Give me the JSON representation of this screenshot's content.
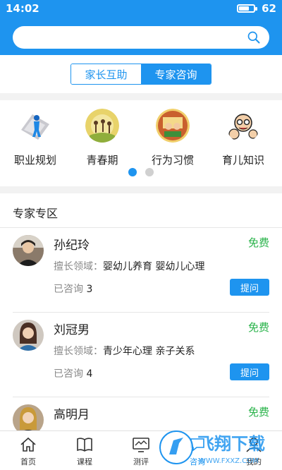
{
  "status": {
    "time": "14:02",
    "battery_level": "62",
    "battery_fraction": 0.62
  },
  "search": {
    "placeholder": ""
  },
  "segment": {
    "left_label": "家长互助",
    "right_label": "专家咨询",
    "selected": "专家咨询"
  },
  "categories": [
    {
      "label": "职业规划",
      "icon": "career-planning-icon"
    },
    {
      "label": "青春期",
      "icon": "adolescence-icon"
    },
    {
      "label": "行为习惯",
      "icon": "behavior-habits-icon"
    },
    {
      "label": "育儿知识",
      "icon": "parenting-knowledge-icon"
    }
  ],
  "pager": {
    "page_count": 2,
    "current_page": 1
  },
  "experts_section": {
    "title": "专家专区"
  },
  "experts": [
    {
      "name": "孙纪玲",
      "free_label": "免费",
      "field_key": "擅长领域：",
      "field_value": "婴幼儿养育 婴幼儿心理",
      "consulted_label": "已咨询",
      "consulted_count": "3",
      "ask_label": "提问"
    },
    {
      "name": "刘冠男",
      "free_label": "免费",
      "field_key": "擅长领域：",
      "field_value": "青少年心理 亲子关系",
      "consulted_label": "已咨询",
      "consulted_count": "4",
      "ask_label": "提问"
    },
    {
      "name": "高明月",
      "free_label": "免费",
      "field_key": "",
      "field_value": "",
      "consulted_label": "",
      "consulted_count": "",
      "ask_label": ""
    }
  ],
  "nav": [
    {
      "label": "首页",
      "icon": "home-icon"
    },
    {
      "label": "课程",
      "icon": "book-icon"
    },
    {
      "label": "测评",
      "icon": "monitor-icon"
    },
    {
      "label": "咨询",
      "icon": "consult-icon",
      "active": true
    },
    {
      "label": "我的",
      "icon": "profile-icon"
    }
  ],
  "watermark": {
    "text": "飞翔下载",
    "site": "WWW.FXXZ.COM"
  },
  "colors": {
    "primary": "#1e94ef",
    "free_green": "#29b34a",
    "background": "#f2f2f2"
  }
}
